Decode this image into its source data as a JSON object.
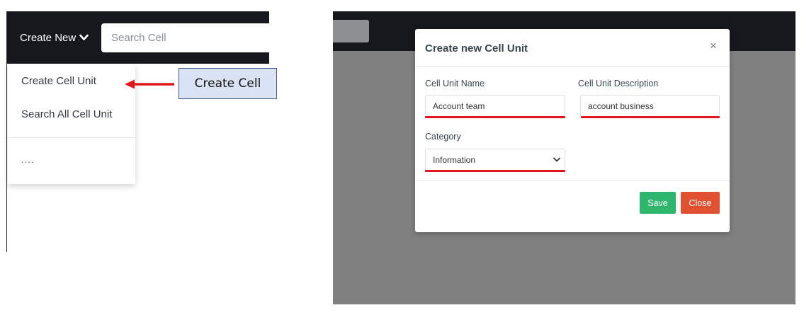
{
  "navbar": {
    "create_new_label": "Create New",
    "search_placeholder": "Search Cell"
  },
  "dropdown": {
    "items": [
      {
        "label": "Create Cell Unit"
      },
      {
        "label": "Search All Cell Unit"
      }
    ],
    "more_label": "...."
  },
  "annotation": {
    "callout_label": "Create Cell",
    "arrow_color": "#e3151c",
    "callout_fill": "#dae3f3"
  },
  "modal": {
    "title": "Create new Cell Unit",
    "close_icon": "×",
    "fields": {
      "name": {
        "label": "Cell Unit Name",
        "value": "Account team"
      },
      "description": {
        "label": "Cell Unit Description",
        "value": "account business"
      },
      "category": {
        "label": "Category",
        "selected": "Information"
      }
    },
    "buttons": {
      "save": "Save",
      "close": "Close"
    },
    "highlight_color": "#e3151c"
  },
  "colors": {
    "navbar_bg": "#16181d",
    "overlay_bg": "#808080",
    "save_btn": "#2eb66e",
    "close_btn": "#e0522f"
  }
}
